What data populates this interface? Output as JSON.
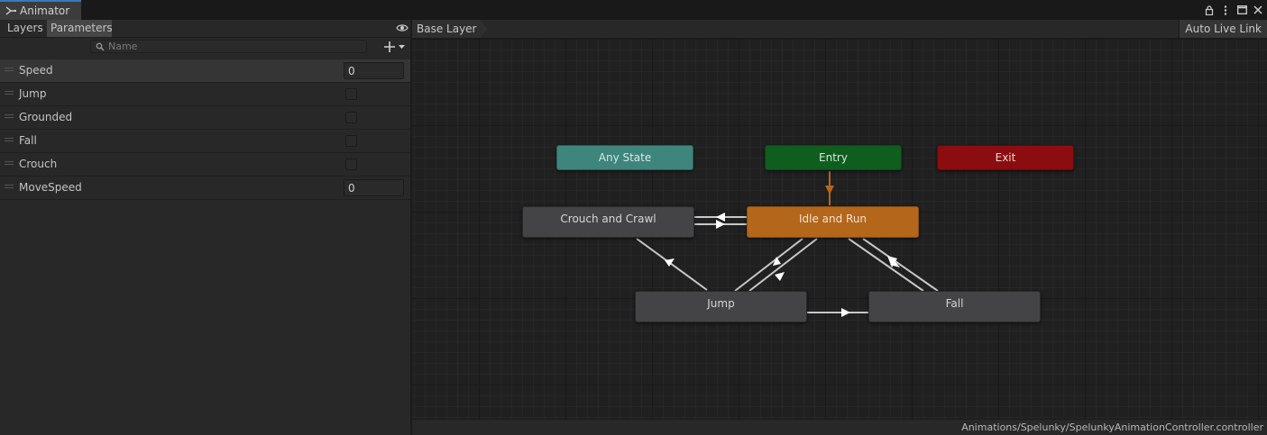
{
  "window": {
    "tab_title": "Animator",
    "tab_icon": "animator-icon",
    "controls": [
      "lock-icon",
      "kebab-menu-icon",
      "maximize-icon",
      "close-icon"
    ]
  },
  "left_panel": {
    "tabs": {
      "layers": "Layers",
      "parameters": "Parameters"
    },
    "search_placeholder": "Name",
    "parameters": [
      {
        "name": "Speed",
        "type": "float",
        "value": "0"
      },
      {
        "name": "Jump",
        "type": "bool",
        "value": false
      },
      {
        "name": "Grounded",
        "type": "bool",
        "value": false
      },
      {
        "name": "Fall",
        "type": "bool",
        "value": false
      },
      {
        "name": "Crouch",
        "type": "bool",
        "value": false
      },
      {
        "name": "MoveSpeed",
        "type": "float",
        "value": "0"
      }
    ]
  },
  "graph": {
    "breadcrumb": "Base Layer",
    "auto_live_link": "Auto Live Link",
    "states": {
      "any_state": "Any State",
      "entry": "Entry",
      "exit": "Exit",
      "crouch": "Crouch and Crawl",
      "idle_run": "Idle and Run",
      "jump": "Jump",
      "fall": "Fall"
    },
    "colors": {
      "any_state": "#3e857c",
      "entry": "#0f5e1f",
      "exit": "#8b0d10",
      "default_state": "#b4661a",
      "state": "#444446",
      "transition": "#c8c8c8",
      "default_transition": "#b4661a"
    }
  },
  "status_bar": {
    "asset_path": "Animations/Spelunky/SpelunkyAnimationController.controller"
  }
}
